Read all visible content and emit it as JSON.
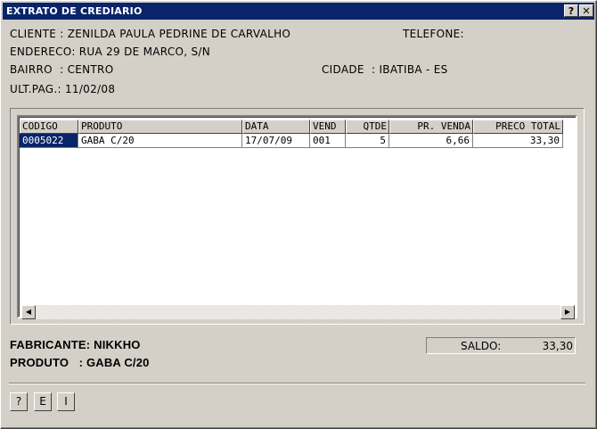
{
  "window": {
    "title": "EXTRATO DE CREDIARIO",
    "help_btn": "?",
    "close_btn": "✕"
  },
  "customer": {
    "cliente": "CLIENTE : ZENILDA PAULA PEDRINE DE CARVALHO",
    "telefone": "TELEFONE:",
    "endereco": "ENDERECO: RUA 29 DE MARCO, S/N",
    "bairro": "BAIRRO  : CENTRO",
    "cidade": "CIDADE  : IBATIBA - ES",
    "ult_pag": "ULT.PAG.: 11/02/08"
  },
  "grid": {
    "columns": [
      "CODIGO",
      "PRODUTO",
      "DATA",
      "VEND",
      "QTDE",
      "PR. VENDA",
      "PRECO TOTAL"
    ],
    "rows": [
      {
        "codigo": "0005022",
        "produto": "GABA C/20",
        "data": "17/07/09",
        "vend": "001",
        "qtde": "5",
        "pr_venda": "6,66",
        "preco_total": "33,30"
      }
    ]
  },
  "details": {
    "fabricante": "FABRICANTE: NIKKHO",
    "produto": "PRODUTO   : GABA C/20"
  },
  "saldo": {
    "label": "SALDO:",
    "value": "33,30"
  },
  "buttons": {
    "help": "?",
    "e": "E",
    "i": "I"
  }
}
